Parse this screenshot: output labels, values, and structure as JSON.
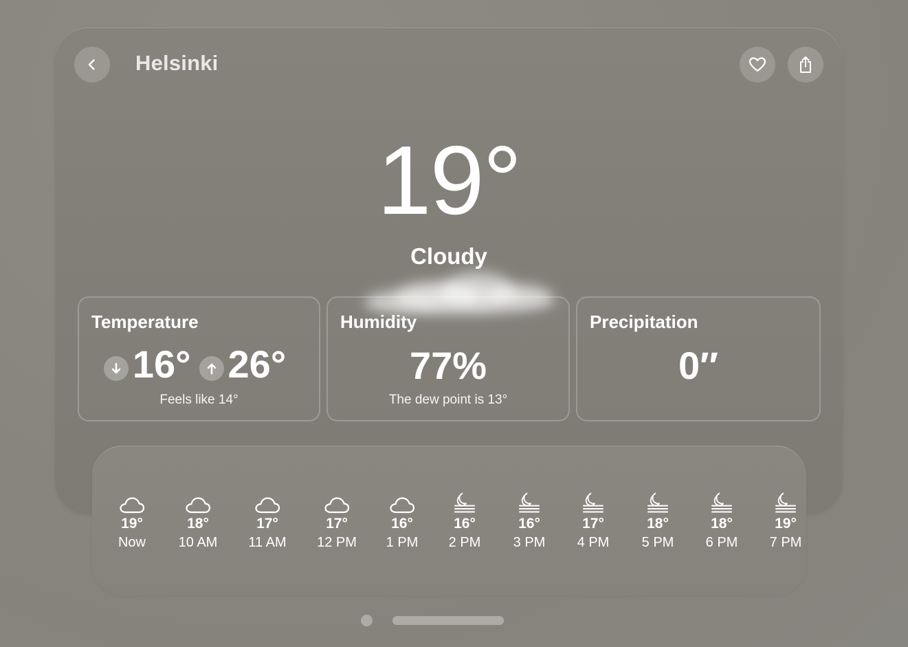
{
  "header": {
    "city": "Helsinki"
  },
  "current": {
    "temperature": "19°",
    "condition": "Cloudy"
  },
  "cards": {
    "temperature": {
      "title": "Temperature",
      "low": "16°",
      "high": "26°",
      "sub": "Feels like 14°"
    },
    "humidity": {
      "title": "Humidity",
      "value": "77%",
      "sub": "The dew point is 13°"
    },
    "precipitation": {
      "title": "Precipitation",
      "value": "0″"
    }
  },
  "hourly": [
    {
      "temp": "19°",
      "label": "Now",
      "icon": "cloud-icon"
    },
    {
      "temp": "18°",
      "label": "10 AM",
      "icon": "cloud-icon"
    },
    {
      "temp": "17°",
      "label": "11 AM",
      "icon": "cloud-icon"
    },
    {
      "temp": "17°",
      "label": "12 PM",
      "icon": "cloud-icon"
    },
    {
      "temp": "16°",
      "label": "1 PM",
      "icon": "cloud-icon"
    },
    {
      "temp": "16°",
      "label": "2 PM",
      "icon": "moon-fog-icon"
    },
    {
      "temp": "16°",
      "label": "3 PM",
      "icon": "moon-fog-icon"
    },
    {
      "temp": "17°",
      "label": "4 PM",
      "icon": "moon-fog-icon"
    },
    {
      "temp": "18°",
      "label": "5 PM",
      "icon": "moon-fog-icon"
    },
    {
      "temp": "18°",
      "label": "6 PM",
      "icon": "moon-fog-icon"
    },
    {
      "temp": "19°",
      "label": "7 PM",
      "icon": "moon-fog-icon"
    }
  ],
  "icons": {
    "back": "chevron-left-icon",
    "favorite": "heart-icon",
    "share": "share-icon",
    "low": "arrow-down-icon",
    "high": "arrow-up-icon"
  },
  "pager": {
    "pages": 2,
    "current": 2
  }
}
